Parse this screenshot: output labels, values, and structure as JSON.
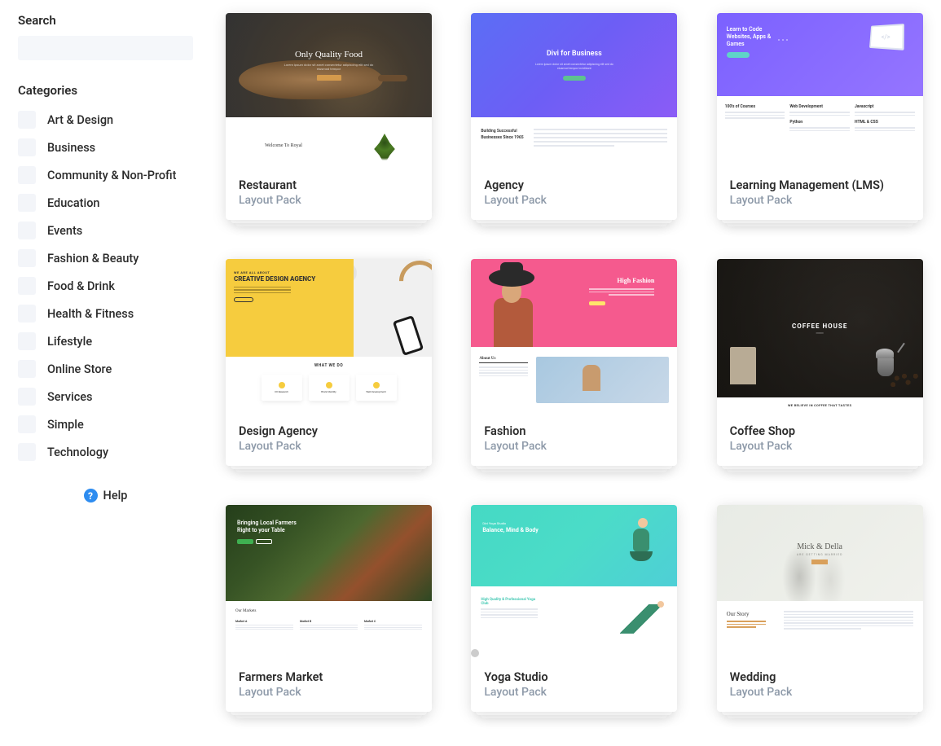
{
  "sidebar": {
    "search_label": "Search",
    "search_value": "",
    "categories_label": "Categories",
    "categories": [
      {
        "label": "Art & Design"
      },
      {
        "label": "Business"
      },
      {
        "label": "Community & Non-Profit"
      },
      {
        "label": "Education"
      },
      {
        "label": "Events"
      },
      {
        "label": "Fashion & Beauty"
      },
      {
        "label": "Food & Drink"
      },
      {
        "label": "Health & Fitness"
      },
      {
        "label": "Lifestyle"
      },
      {
        "label": "Online Store"
      },
      {
        "label": "Services"
      },
      {
        "label": "Simple"
      },
      {
        "label": "Technology"
      }
    ],
    "help_label": "Help"
  },
  "layouts": [
    {
      "title": "Restaurant",
      "subtitle": "Layout Pack",
      "thumb": {
        "hero_title": "Only Quality Food",
        "lower_title": "Welcome To Royal"
      }
    },
    {
      "title": "Agency",
      "subtitle": "Layout Pack",
      "thumb": {
        "hero_title": "Divi for Business",
        "lower_t1": "Building Successful",
        "lower_t2": "Businesses Since 1965"
      }
    },
    {
      "title": "Learning Management (LMS)",
      "subtitle": "Layout Pack",
      "thumb": {
        "hero_title": "Learn to Code Websites, Apps & Games",
        "lower_col1": "100's of Courses",
        "lower_col2": "Web Development",
        "lower_col3": "Javascript",
        "lower_col2b": "Python",
        "lower_col3b": "HTML & CSS"
      }
    },
    {
      "title": "Design Agency",
      "subtitle": "Layout Pack",
      "thumb": {
        "t_sm": "WE ARE ALL ABOUT",
        "t_lg": "CREATIVE DESIGN AGENCY",
        "lower_title": "WHAT WE DO",
        "box1": "UX Research",
        "box2": "Brand Identity",
        "box3": "Web Development"
      }
    },
    {
      "title": "Fashion",
      "subtitle": "Layout Pack",
      "thumb": {
        "hero_title": "High Fashion",
        "lower_title": "About Us"
      }
    },
    {
      "title": "Coffee Shop",
      "subtitle": "Layout Pack",
      "thumb": {
        "hero_title": "COFFEE HOUSE",
        "lower_title": "WE BELIEVE IN COFFEE THAT TASTES"
      }
    },
    {
      "title": "Farmers Market",
      "subtitle": "Layout Pack",
      "thumb": {
        "hero_title": "Bringing Local Farmers Right to your Table",
        "lower_title": "Our Markets"
      }
    },
    {
      "title": "Yoga Studio",
      "subtitle": "Layout Pack",
      "thumb": {
        "hero_sub": "Divi Yoga Studio",
        "hero_title": "Balance, Mind & Body",
        "lower_title": "High Quality & Professional Yoga Club"
      }
    },
    {
      "title": "Wedding",
      "subtitle": "Layout Pack",
      "thumb": {
        "hero_title": "Mick & Della",
        "hero_sub": "ARE GETTING MARRIED",
        "lower_title": "Our Story"
      }
    }
  ]
}
